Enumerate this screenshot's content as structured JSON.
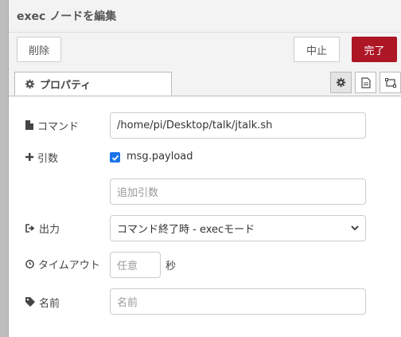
{
  "dialog": {
    "title": "exec ノードを編集"
  },
  "toolbar": {
    "delete_label": "削除",
    "cancel_label": "中止",
    "done_label": "完了"
  },
  "tabs": {
    "properties_label": "プロパティ",
    "side_icons": [
      "gear-icon",
      "description-icon",
      "appearance-icon"
    ]
  },
  "form": {
    "command": {
      "label": "コマンド",
      "value": "/home/pi/Desktop/talk/jtalk.sh"
    },
    "args": {
      "label": "引数",
      "payload_label": "msg.payload",
      "payload_checked": true,
      "extra_placeholder": "追加引数"
    },
    "output": {
      "label": "出力",
      "selected": "コマンド終了時 - execモード"
    },
    "timeout": {
      "label": "タイムアウト",
      "placeholder": "任意",
      "unit": "秒"
    },
    "name": {
      "label": "名前",
      "placeholder": "名前"
    }
  },
  "colors": {
    "accent": "#ad1625",
    "checkbox": "#1a73e8"
  }
}
